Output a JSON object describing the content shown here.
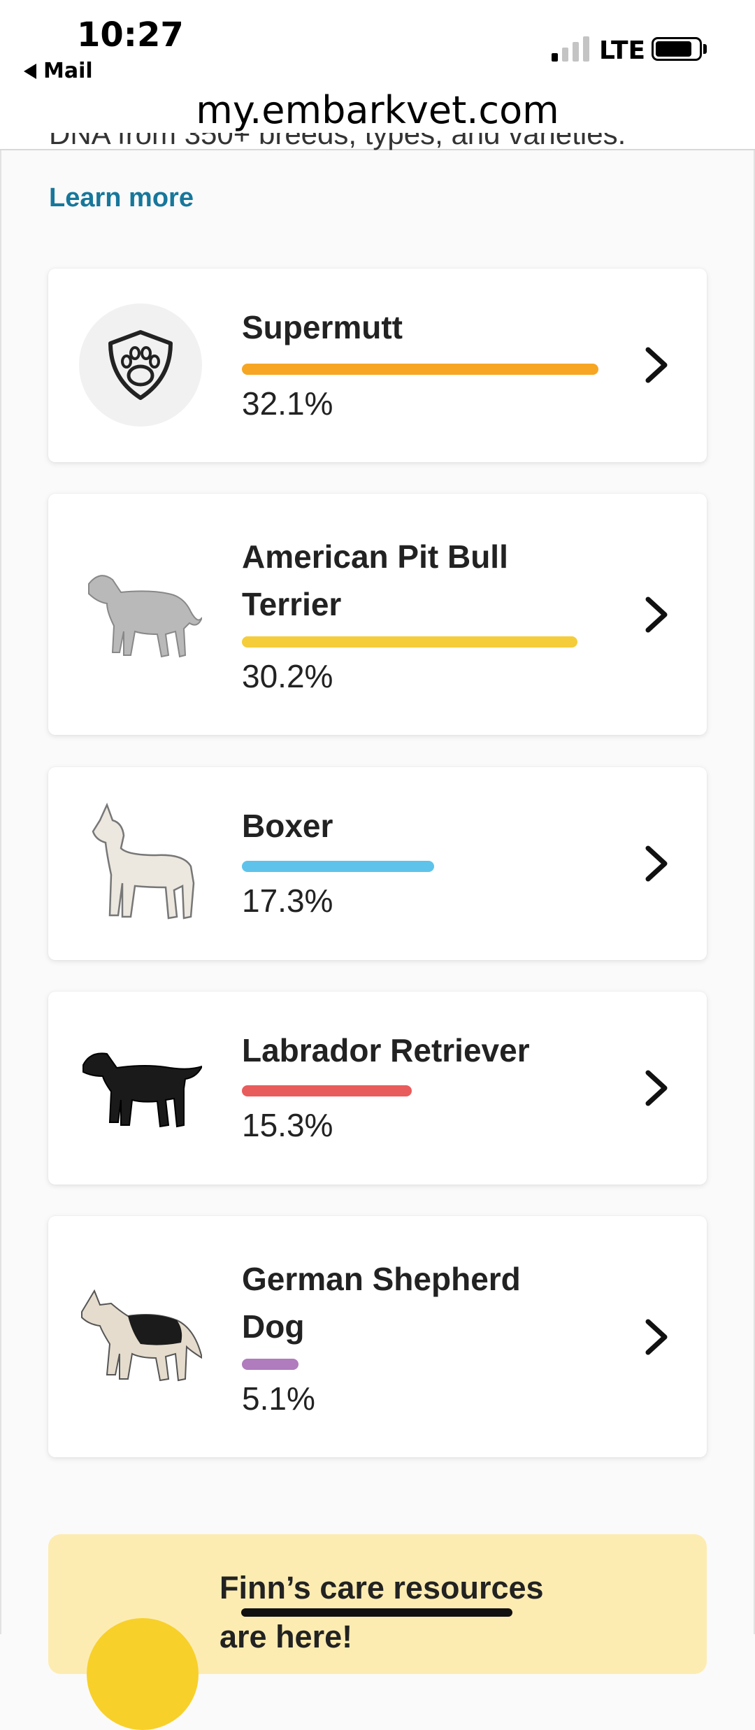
{
  "status_bar": {
    "time": "10:27",
    "back_app": "Mail",
    "network": "LTE",
    "signal_bars_on": 1,
    "signal_bars_total": 4,
    "battery_level": 0.85
  },
  "browser": {
    "url": "my.embarkvet.com"
  },
  "intro": {
    "cut_text": "DNA from 350+ breeds, types, and varieties.",
    "learn_more": "Learn more"
  },
  "breeds": [
    {
      "name": "Supermutt",
      "percent": "32.1%",
      "value": 32.1,
      "color": "#f6a623",
      "icon": "paw-shield-icon"
    },
    {
      "name": "American Pit Bull Terrier",
      "percent": "30.2%",
      "value": 30.2,
      "color": "#f5cd3a",
      "icon": "pit-bull-dog-icon"
    },
    {
      "name": "Boxer",
      "percent": "17.3%",
      "value": 17.3,
      "color": "#5ec3ea",
      "icon": "boxer-dog-icon"
    },
    {
      "name": "Labrador Retriever",
      "percent": "15.3%",
      "value": 15.3,
      "color": "#e95c5c",
      "icon": "labrador-dog-icon"
    },
    {
      "name": "German Shepherd Dog",
      "percent": "5.1%",
      "value": 5.1,
      "color": "#b07cbd",
      "icon": "german-shepherd-dog-icon"
    }
  ],
  "care_banner": {
    "title": "Finn’s care resources are here!"
  }
}
